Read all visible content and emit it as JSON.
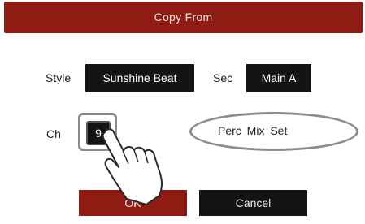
{
  "dialog": {
    "title": "Copy From",
    "style_label": "Style",
    "style_value": "Sunshine Beat",
    "sec_label": "Sec",
    "sec_value": "Main A",
    "ch_label": "Ch",
    "ch_value": "9",
    "perc_text": "Perc  Mix Set",
    "ok_label": "OK",
    "cancel_label": "Cancel"
  },
  "colors": {
    "accent": "#8e1c12",
    "field_bg": "#141414",
    "highlight": "#8c8c8c"
  },
  "icons": {
    "pointer": "pointing-hand-icon"
  }
}
